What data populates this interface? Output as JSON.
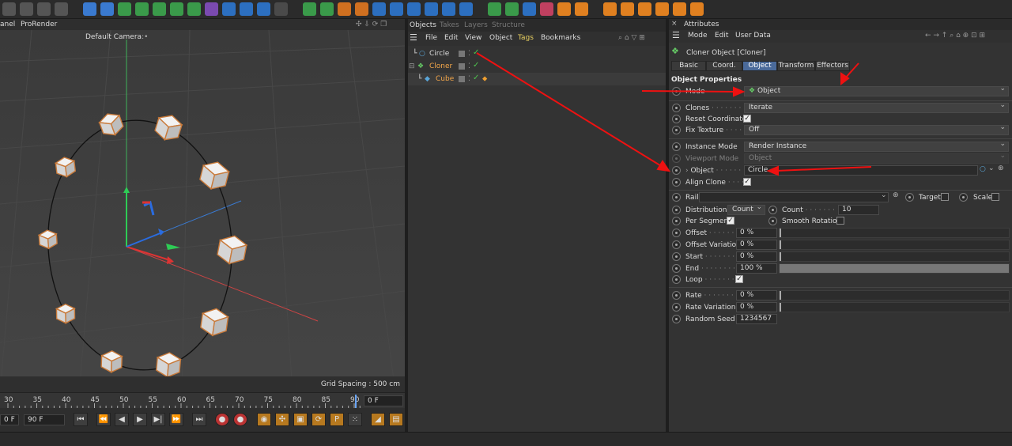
{
  "toolbar": {
    "icons": [
      "undo",
      "redo",
      "film",
      "clapboard",
      "play-icon",
      "cube",
      "pen",
      "spline",
      "nurbs",
      "cloner",
      "deformer",
      "scene",
      "light",
      "camera",
      "bend",
      "floor",
      "effectors",
      "bulb",
      "move",
      "scale",
      "rotate",
      "render",
      "render-region",
      "render-settings",
      "hair",
      "particles",
      "material",
      "sky",
      "texture",
      "key",
      "knife",
      "bevel",
      "loop",
      "extrude",
      "brush",
      "sculpt",
      "paint",
      "plugins"
    ]
  },
  "viewport": {
    "menu": [
      "anel",
      "ProRender"
    ],
    "camera": "Default Camera",
    "camera_icon": ":•",
    "grid_spacing": "Grid Spacing : 500 cm"
  },
  "timeline": {
    "ticks": [
      "30",
      "35",
      "40",
      "45",
      "50",
      "55",
      "60",
      "65",
      "70",
      "75",
      "80",
      "85",
      "90"
    ],
    "end_frame_field": "0 F",
    "start_field": "0 F",
    "max_field": "90 F"
  },
  "objects": {
    "tabs": [
      "Objects",
      "Takes",
      "Layers",
      "Structure"
    ],
    "menu": [
      "File",
      "Edit",
      "View",
      "Object",
      "Tags",
      "Bookmarks"
    ],
    "rows": [
      {
        "name": "Circle",
        "color": "#dddddd"
      },
      {
        "name": "Cloner",
        "color": "#f2a64a"
      },
      {
        "name": "Cube",
        "color": "#f2a64a"
      }
    ]
  },
  "attributes": {
    "title": "Attributes",
    "menu": [
      "Mode",
      "Edit",
      "User Data"
    ],
    "object_label": "Cloner Object [Cloner]",
    "tabs": [
      "Basic",
      "Coord.",
      "Object",
      "Transform",
      "Effectors"
    ],
    "active_tab": "Object",
    "section": "Object Properties",
    "props": {
      "mode": {
        "label": "Mode",
        "value": "Object"
      },
      "clones": {
        "label": "Clones",
        "value": "Iterate"
      },
      "reset_coords": {
        "label": "Reset Coordinates"
      },
      "fix_texture": {
        "label": "Fix Texture",
        "value": "Off"
      },
      "instance_mode": {
        "label": "Instance Mode",
        "value": "Render Instance"
      },
      "viewport_mode": {
        "label": "Viewport Mode",
        "value": "Object"
      },
      "object": {
        "label": "Object",
        "value": "Circle"
      },
      "align_clone": {
        "label": "Align Clone"
      },
      "rail": {
        "label": "Rail",
        "value": ""
      },
      "target": {
        "label": "Target"
      },
      "scale": {
        "label": "Scale"
      },
      "distribution": {
        "label": "Distribution",
        "value": "Count"
      },
      "count": {
        "label": "Count",
        "value": "10"
      },
      "per_segment": {
        "label": "Per Segment"
      },
      "smooth_rotation": {
        "label": "Smooth Rotation"
      },
      "offset": {
        "label": "Offset",
        "value": "0 %",
        "fill": 0
      },
      "offset_variation": {
        "label": "Offset Variation",
        "value": "0 %",
        "fill": 0
      },
      "start": {
        "label": "Start",
        "value": "0 %",
        "fill": 0
      },
      "end": {
        "label": "End",
        "value": "100 %",
        "fill": 1
      },
      "loop": {
        "label": "Loop"
      },
      "rate": {
        "label": "Rate",
        "value": "0 %",
        "fill": 0
      },
      "rate_variation": {
        "label": "Rate Variation",
        "value": "0 %",
        "fill": 0
      },
      "random_seed": {
        "label": "Random Seed",
        "value": "1234567"
      }
    }
  }
}
